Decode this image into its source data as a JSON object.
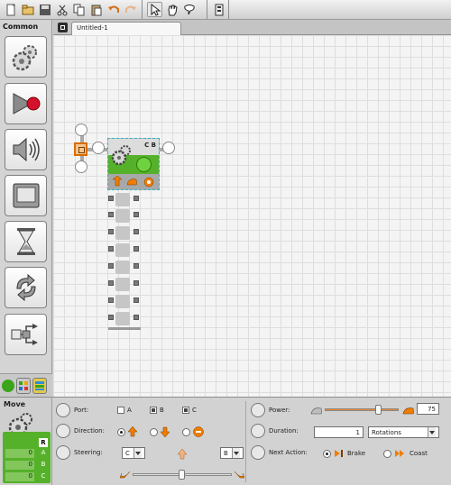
{
  "palette": {
    "title": "Common",
    "items": [
      {
        "name": "move-block",
        "icon": "gears-icon"
      },
      {
        "name": "record-play-block",
        "icon": "record-play-icon"
      },
      {
        "name": "sound-block",
        "icon": "speaker-icon"
      },
      {
        "name": "display-block",
        "icon": "display-icon"
      },
      {
        "name": "wait-block",
        "icon": "hourglass-icon"
      },
      {
        "name": "loop-block",
        "icon": "loop-icon"
      },
      {
        "name": "switch-block",
        "icon": "switch-icon"
      }
    ],
    "tabs": [
      "common-tab",
      "complete-tab",
      "custom-tab"
    ]
  },
  "editor": {
    "tab_title": "Untitled-1",
    "move_block_ports": "C B"
  },
  "config": {
    "block_title": "Move",
    "preview": {
      "r_badge": "R",
      "rows": [
        {
          "value": "0",
          "port": "A"
        },
        {
          "value": "0",
          "port": "B"
        },
        {
          "value": "0",
          "port": "C"
        }
      ]
    },
    "port": {
      "label": "Port:",
      "options": [
        {
          "label": "A",
          "checked": false
        },
        {
          "label": "B",
          "checked": true
        },
        {
          "label": "C",
          "checked": true
        }
      ]
    },
    "direction": {
      "label": "Direction:"
    },
    "steering": {
      "label": "Steering:",
      "left_motor": "C",
      "right_motor": "B"
    },
    "power": {
      "label": "Power:",
      "value": "75",
      "level": 75
    },
    "duration": {
      "label": "Duration:",
      "value": "1",
      "unit": "Rotations"
    },
    "next_action": {
      "label": "Next Action:",
      "brake": "Brake",
      "coast": "Coast"
    }
  }
}
